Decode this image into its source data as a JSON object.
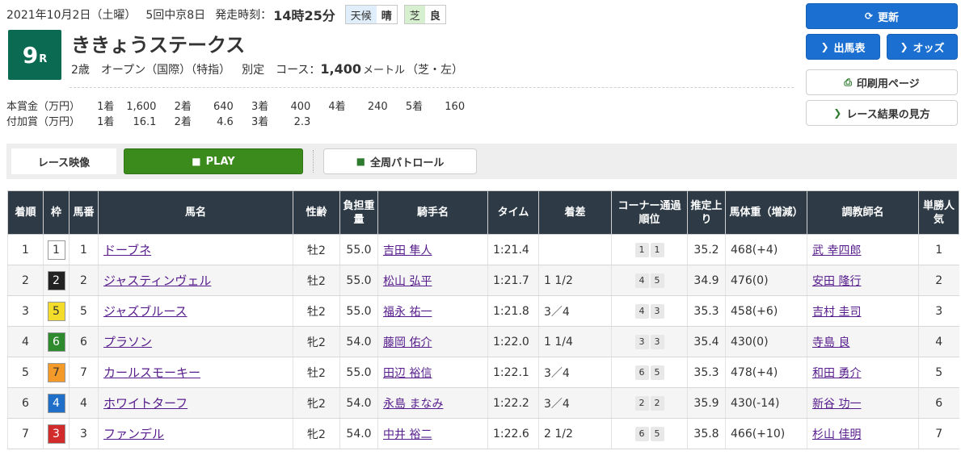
{
  "header": {
    "date": "2021年10月2日（土曜）",
    "meeting": "5回中京8日",
    "post_time_label": "発走時刻：",
    "post_time": "14時25分",
    "weather_label": "天候",
    "weather": "晴",
    "track_label": "芝",
    "track_condition": "良"
  },
  "race": {
    "number": "9",
    "suffix": "R",
    "title": "ききょうステークス",
    "age": "2歳",
    "class": "オープン（国際）（特指）",
    "weight_rule": "別定",
    "course_label": "コース：",
    "distance": "1,400",
    "unit": "メートル",
    "surface": "（芝・左）",
    "badge_color": "#0a6a52"
  },
  "prize": {
    "main_label": "本賞金（万円）",
    "main": [
      {
        "place": "1着",
        "value": "1,600"
      },
      {
        "place": "2着",
        "value": "640"
      },
      {
        "place": "3着",
        "value": "400"
      },
      {
        "place": "4着",
        "value": "240"
      },
      {
        "place": "5着",
        "value": "160"
      }
    ],
    "added_label": "付加賞（万円）",
    "added": [
      {
        "place": "1着",
        "value": "16.1"
      },
      {
        "place": "2着",
        "value": "4.6"
      },
      {
        "place": "3着",
        "value": "2.3"
      }
    ]
  },
  "buttons": {
    "update": "更新",
    "race_card": "出馬表",
    "odds": "オッズ",
    "print": "印刷用ページ",
    "how_to": "レース結果の見方",
    "video_label": "レース映像",
    "play": "PLAY",
    "patrol": "全周パトロール"
  },
  "table": {
    "headers": [
      "着順",
      "枠",
      "馬番",
      "馬名",
      "性齢",
      "負担重量",
      "騎手名",
      "タイム",
      "着差",
      "コーナー通過順位",
      "推定上り",
      "馬体重（増減）",
      "調教師名",
      "単勝人気"
    ],
    "rows": [
      {
        "place": "1",
        "waku": "1",
        "num": "1",
        "horse": "ドーブネ",
        "sex_age": "牡2",
        "weight": "55.0",
        "jockey": "吉田 隼人",
        "time": "1:21.4",
        "margin": "",
        "corner": [
          "1",
          "1"
        ],
        "last3f": "35.2",
        "body_weight": "468(+4)",
        "trainer": "武 幸四郎",
        "pop": "1"
      },
      {
        "place": "2",
        "waku": "2",
        "num": "2",
        "horse": "ジャスティンヴェル",
        "sex_age": "牡2",
        "weight": "55.0",
        "jockey": "松山 弘平",
        "time": "1:21.7",
        "margin": "1 1/2",
        "corner": [
          "4",
          "5"
        ],
        "last3f": "34.9",
        "body_weight": "476(0)",
        "trainer": "安田 隆行",
        "pop": "2"
      },
      {
        "place": "3",
        "waku": "5",
        "num": "5",
        "horse": "ジャズブルース",
        "sex_age": "牡2",
        "weight": "55.0",
        "jockey": "福永 祐一",
        "time": "1:21.8",
        "margin": "3／4",
        "corner": [
          "4",
          "3"
        ],
        "last3f": "35.3",
        "body_weight": "458(+6)",
        "trainer": "吉村 圭司",
        "pop": "3"
      },
      {
        "place": "4",
        "waku": "6",
        "num": "6",
        "horse": "プラソン",
        "sex_age": "牝2",
        "weight": "54.0",
        "jockey": "藤岡 佑介",
        "time": "1:22.0",
        "margin": "1 1/4",
        "corner": [
          "3",
          "3"
        ],
        "last3f": "35.4",
        "body_weight": "430(0)",
        "trainer": "寺島 良",
        "pop": "4"
      },
      {
        "place": "5",
        "waku": "7",
        "num": "7",
        "horse": "カールスモーキー",
        "sex_age": "牡2",
        "weight": "55.0",
        "jockey": "田辺 裕信",
        "time": "1:22.1",
        "margin": "3／4",
        "corner": [
          "6",
          "5"
        ],
        "last3f": "35.3",
        "body_weight": "478(+4)",
        "trainer": "和田 勇介",
        "pop": "5"
      },
      {
        "place": "6",
        "waku": "4",
        "num": "4",
        "horse": "ホワイトターフ",
        "sex_age": "牝2",
        "weight": "54.0",
        "jockey": "永島 まなみ",
        "time": "1:22.2",
        "margin": "3／4",
        "corner": [
          "2",
          "2"
        ],
        "last3f": "35.9",
        "body_weight": "430(-14)",
        "trainer": "新谷 功一",
        "pop": "6"
      },
      {
        "place": "7",
        "waku": "3",
        "num": "3",
        "horse": "ファンデル",
        "sex_age": "牝2",
        "weight": "54.0",
        "jockey": "中井 裕二",
        "time": "1:22.6",
        "margin": "2 1/2",
        "corner": [
          "6",
          "5"
        ],
        "last3f": "35.8",
        "body_weight": "466(+10)",
        "trainer": "杉山 佳明",
        "pop": "7"
      }
    ]
  },
  "waku_colors": {
    "1": {
      "bg": "#ffffff",
      "fg": "#333333"
    },
    "2": {
      "bg": "#222222",
      "fg": "#ffffff"
    },
    "3": {
      "bg": "#d12b2b",
      "fg": "#ffffff"
    },
    "4": {
      "bg": "#1f6fc8",
      "fg": "#ffffff"
    },
    "5": {
      "bg": "#f3dc2a",
      "fg": "#333333"
    },
    "6": {
      "bg": "#2d8a2d",
      "fg": "#ffffff"
    },
    "7": {
      "bg": "#f39a28",
      "fg": "#333333"
    }
  }
}
